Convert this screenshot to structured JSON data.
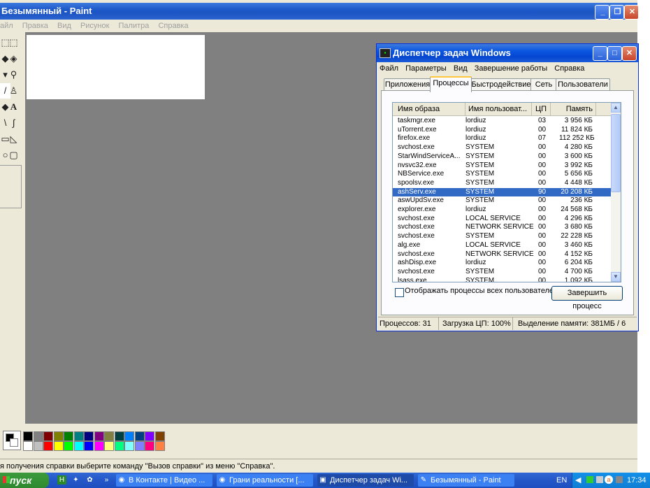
{
  "paint": {
    "title": "Безымянный - Paint",
    "menu": [
      "айл",
      "Правка",
      "Вид",
      "Рисунок",
      "Палитра",
      "Справка"
    ],
    "status": "я получения справки выберите команду \"Вызов справки\" из меню \"Справка\"."
  },
  "taskmgr": {
    "title": "Диспетчер задач Windows",
    "menu": [
      "Файл",
      "Параметры",
      "Вид",
      "Завершение работы",
      "Справка"
    ],
    "tabs": [
      "Приложения",
      "Процессы",
      "Быстродействие",
      "Сеть",
      "Пользователи"
    ],
    "columns": [
      "Имя образа",
      "Имя пользоват...",
      "ЦП",
      "Память"
    ],
    "rows": [
      [
        "taskmgr.exe",
        "lordiuz",
        "03",
        "3 956 КБ"
      ],
      [
        "uTorrent.exe",
        "lordiuz",
        "00",
        "11 824 КБ"
      ],
      [
        "firefox.exe",
        "lordiuz",
        "07",
        "112 252 КБ"
      ],
      [
        "svchost.exe",
        "SYSTEM",
        "00",
        "4 280 КБ"
      ],
      [
        "StarWindServiceA...",
        "SYSTEM",
        "00",
        "3 600 КБ"
      ],
      [
        "nvsvc32.exe",
        "SYSTEM",
        "00",
        "3 992 КБ"
      ],
      [
        "NBService.exe",
        "SYSTEM",
        "00",
        "5 656 КБ"
      ],
      [
        "spoolsv.exe",
        "SYSTEM",
        "00",
        "4 448 КБ"
      ],
      [
        "ashServ.exe",
        "SYSTEM",
        "90",
        "20 208 КБ"
      ],
      [
        "aswUpdSv.exe",
        "SYSTEM",
        "00",
        "236 КБ"
      ],
      [
        "explorer.exe",
        "lordiuz",
        "00",
        "24 568 КБ"
      ],
      [
        "svchost.exe",
        "LOCAL SERVICE",
        "00",
        "4 296 КБ"
      ],
      [
        "svchost.exe",
        "NETWORK SERVICE",
        "00",
        "3 680 КБ"
      ],
      [
        "svchost.exe",
        "SYSTEM",
        "00",
        "22 228 КБ"
      ],
      [
        "alg.exe",
        "LOCAL SERVICE",
        "00",
        "3 460 КБ"
      ],
      [
        "svchost.exe",
        "NETWORK SERVICE",
        "00",
        "4 152 КБ"
      ],
      [
        "ashDisp.exe",
        "lordiuz",
        "00",
        "6 204 КБ"
      ],
      [
        "svchost.exe",
        "SYSTEM",
        "00",
        "4 700 КБ"
      ],
      [
        "lsass.exe",
        "SYSTEM",
        "00",
        "1 092 КБ"
      ]
    ],
    "selected_row": 8,
    "show_all_label": "Отображать процессы всех пользователей",
    "end_process_label": "Завершить процесс",
    "status": {
      "processes": "Процессов: 31",
      "cpu": "Загрузка ЦП: 100%",
      "memory": "Выделение памяти: 381МБ / 6"
    }
  },
  "taskbar": {
    "start_label": "пуск",
    "tasks": [
      {
        "label": "В Контакте | Видео ...",
        "icon": "firefox-icon"
      },
      {
        "label": "Грани реальности [...",
        "icon": "firefox-icon"
      },
      {
        "label": "Диспетчер задач Wi...",
        "icon": "taskmgr-icon"
      },
      {
        "label": "Безымянный - Paint",
        "icon": "paint-icon"
      }
    ],
    "active_task": 2,
    "language": "EN",
    "clock": "17:34"
  },
  "palette_colors": [
    "#000000",
    "#808080",
    "#800000",
    "#808000",
    "#008000",
    "#008080",
    "#000080",
    "#800080",
    "#808040",
    "#004040",
    "#0080ff",
    "#004080",
    "#8000ff",
    "#804000",
    "#ffffff",
    "#c0c0c0",
    "#ff0000",
    "#ffff00",
    "#00ff00",
    "#00ffff",
    "#0000ff",
    "#ff00ff",
    "#ffff80",
    "#00ff80",
    "#80ffff",
    "#8080ff",
    "#ff0080",
    "#ff8040"
  ]
}
